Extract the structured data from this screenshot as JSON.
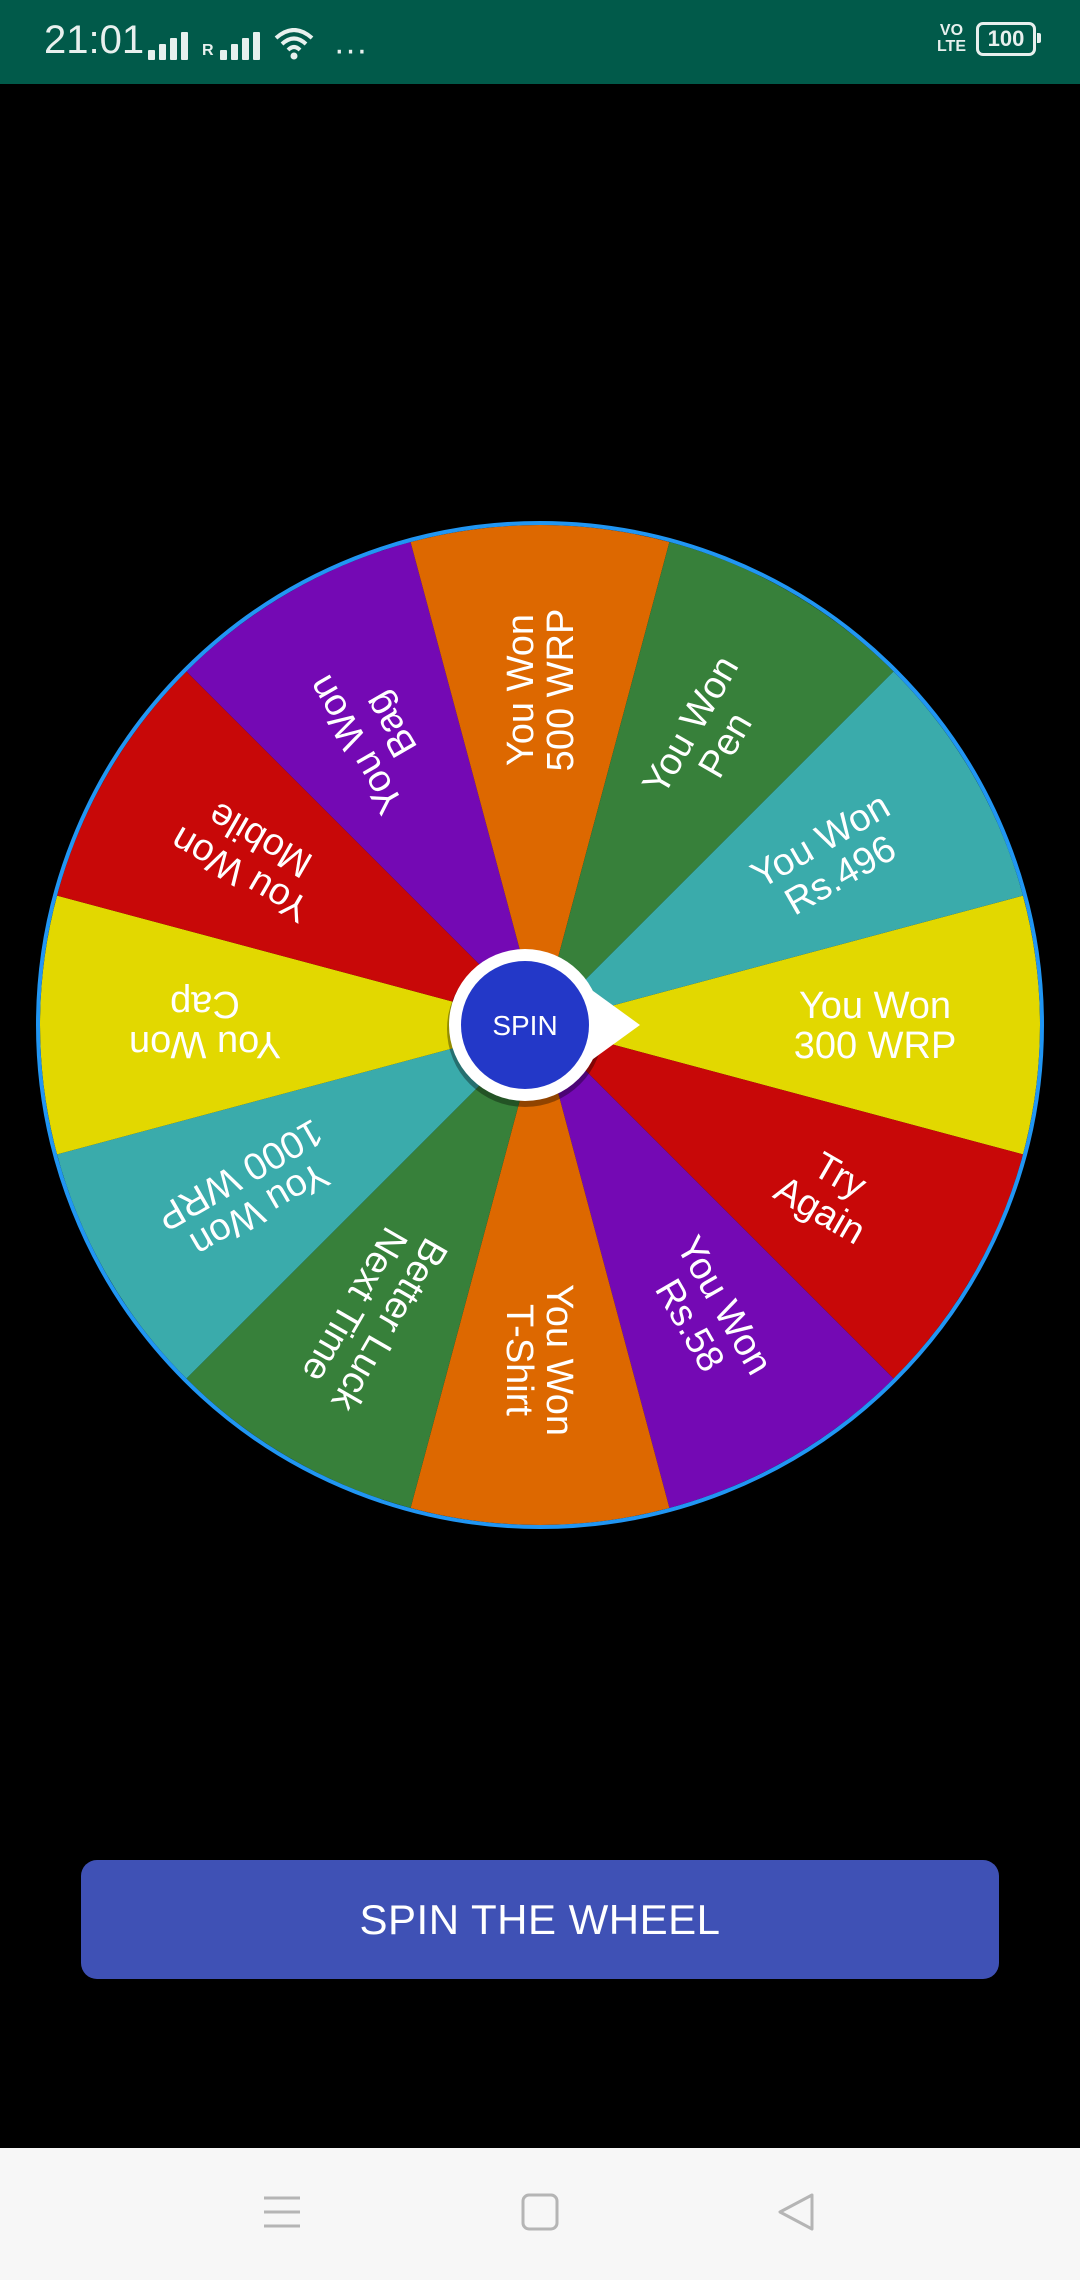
{
  "status_bar": {
    "time": "21:01",
    "signal_r": "R",
    "more": "···",
    "volte_line1": "VO",
    "volte_line2": "LTE",
    "battery": "100",
    "background_color": "#015a4a"
  },
  "wheel": {
    "border_color": "#2196f3",
    "center_label": "SPIN",
    "center_color": "#2338c8",
    "segments": [
      {
        "lines": [
          "You Won",
          "300 WRP"
        ],
        "color": "#e2d800"
      },
      {
        "lines": [
          "Try",
          "Again"
        ],
        "color": "#c80808"
      },
      {
        "lines": [
          "You Won",
          "Rs.58"
        ],
        "color": "#7409b4"
      },
      {
        "lines": [
          "You Won",
          "T-Shirt"
        ],
        "color": "#dd6800"
      },
      {
        "lines": [
          "Better Luck",
          "Next Time"
        ],
        "color": "#37803a"
      },
      {
        "lines": [
          "You Won",
          "1000 WRP"
        ],
        "color": "#3aabab"
      },
      {
        "lines": [
          "You Won",
          "Cap"
        ],
        "color": "#e2d800"
      },
      {
        "lines": [
          "You Won",
          "Mobile"
        ],
        "color": "#c80808"
      },
      {
        "lines": [
          "You Won",
          "Bag"
        ],
        "color": "#7409b4"
      },
      {
        "lines": [
          "You Won",
          "500 WRP"
        ],
        "color": "#dd6800"
      },
      {
        "lines": [
          "You Won",
          "Pen"
        ],
        "color": "#37803a"
      },
      {
        "lines": [
          "You Won",
          "Rs.496"
        ],
        "color": "#3aabab"
      }
    ]
  },
  "spin_button": {
    "label": "SPIN THE WHEEL",
    "color": "#3f51b5"
  },
  "nav_bar": {
    "icons": [
      "menu-icon",
      "home-square-icon",
      "back-triangle-icon"
    ]
  }
}
